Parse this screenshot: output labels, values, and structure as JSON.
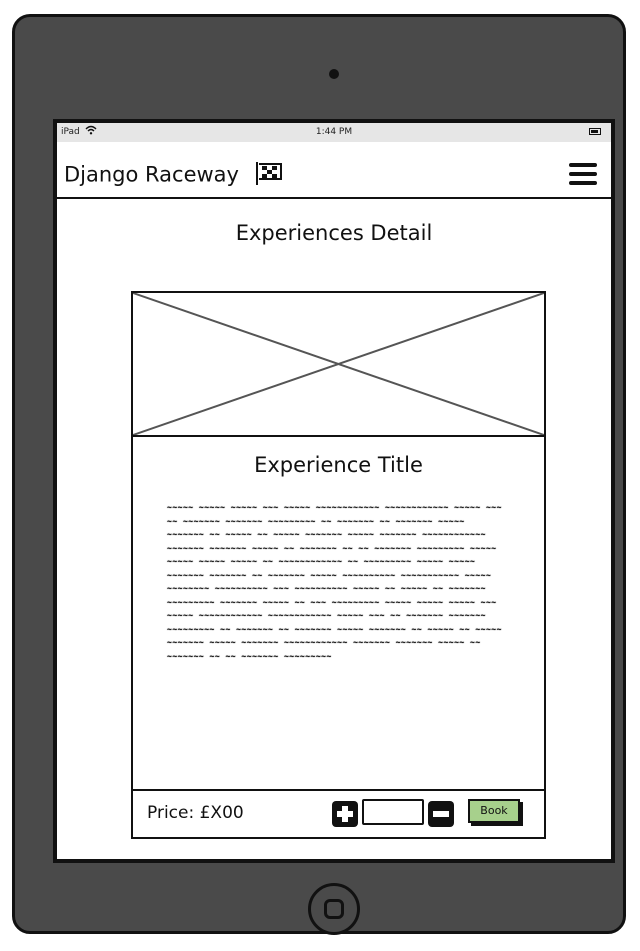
{
  "status_bar": {
    "carrier": "iPad",
    "time": "1:44 PM"
  },
  "navbar": {
    "brand": "Django Raceway",
    "brand_icon": "checkered-flag-icon",
    "menu_icon": "hamburger-menu-icon"
  },
  "page": {
    "title": "Experiences Detail"
  },
  "card": {
    "image": "image-placeholder",
    "title": "Experience Title",
    "description": "~~~~~ ~~~~~ ~~~~~ ~~~ ~~~~~ ~~~~~~~~~~~~ ~~~~~~~~~~~~ ~~~~~ ~~~ ~~ ~~~~~~~ ~~~~~~~ ~~~~~~~~~ ~~ ~~~~~~~ ~~ ~~~~~~~ ~~~~~ ~~~~~~~ ~~ ~~~~~ ~~ ~~~~~ ~~~~~~~ ~~~~~ ~~~~~~~ ~~~~~~~~~~~~ ~~~~~~~ ~~~~~~~ ~~~~~ ~~ ~~~~~~~ ~~ ~~ ~~~~~~~ ~~~~~~~~~ ~~~~~ ~~~~~ ~~~~~ ~~~~~ ~~ ~~~~~~~~~~~~ ~~ ~~~~~~~~~ ~~~~~ ~~~~~ ~~~~~~~ ~~~~~~~ ~~ ~~~~~~~ ~~~~~ ~~~~~~~~~~ ~~~~~~~~~~~ ~~~~~ ~~~~~~~~ ~~~~~~~~~~ ~~~ ~~~~~~~~~~ ~~~~~ ~~ ~~~~~ ~~ ~~~~~~~ ~~~~~~~~~ ~~~~~~~ ~~~~~ ~~ ~~~ ~~~~~~~~~ ~~~~~ ~~~~~ ~~~~~ ~~~ ~~~~~ ~~~~~~~~~~~~ ~~~~~~~~~~~~ ~~~~~ ~~~ ~~ ~~~~~~~ ~~~~~~~ ~~~~~~~~~ ~~ ~~~~~~~ ~~ ~~~~~~~ ~~~~~ ~~~~~~~ ~~ ~~~~~ ~~ ~~~~~ ~~~~~~~ ~~~~~ ~~~~~~~ ~~~~~~~~~~~~ ~~~~~~~ ~~~~~~~ ~~~~~ ~~ ~~~~~~~ ~~ ~~ ~~~~~~~ ~~~~~~~~~",
    "price_label": "Price: £X00",
    "quantity_value": "",
    "plus_icon": "plus-icon",
    "minus_icon": "minus-icon",
    "book_label": "Book",
    "book_color": "#a7d08c"
  },
  "device": {
    "frame_color": "#4a4a4a"
  }
}
